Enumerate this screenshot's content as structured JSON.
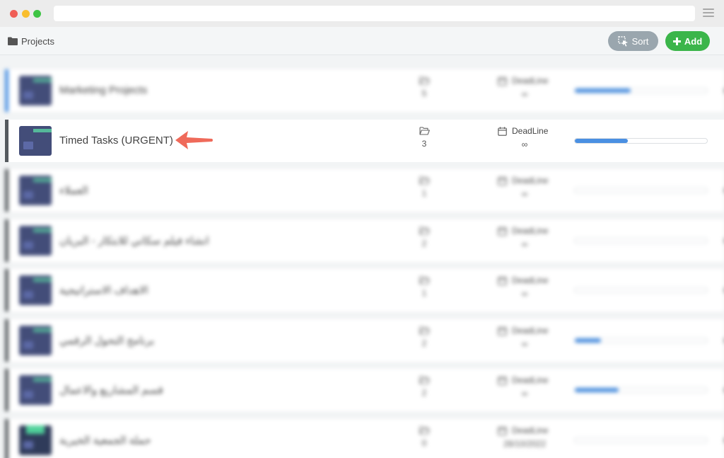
{
  "window": {},
  "breadcrumb": {
    "label": "Projects",
    "icon": "folder-icon"
  },
  "toolbar": {
    "sort_label": "Sort",
    "add_label": "Add",
    "sort_color": "#9aa6ae",
    "add_color": "#3bb54a"
  },
  "projects": [
    {
      "name": "Marketing Projects",
      "count": "5",
      "deadline_label": "DeadLine",
      "deadline": "∞",
      "progress": 0.42,
      "blurred": true
    },
    {
      "name": "Timed Tasks (URGENT)",
      "count": "3",
      "deadline_label": "DeadLine",
      "deadline": "∞",
      "progress": 0.4,
      "blurred": false,
      "highlighted": true
    },
    {
      "name": "العملاء",
      "count": "1",
      "deadline_label": "DeadLine",
      "deadline": "∞",
      "progress": 0,
      "blurred": true
    },
    {
      "name": "انشاء فيلم سكاني للابتكار - البريان",
      "count": "2",
      "deadline_label": "DeadLine",
      "deadline": "∞",
      "progress": 0,
      "blurred": true
    },
    {
      "name": "الاهداف الاستراتيجية",
      "count": "1",
      "deadline_label": "DeadLine",
      "deadline": "∞",
      "progress": 0,
      "blurred": true
    },
    {
      "name": "برنامج التحول الرقمي",
      "count": "2",
      "deadline_label": "DeadLine",
      "deadline": "∞",
      "progress": 0.2,
      "blurred": true
    },
    {
      "name": "قسم المشاريع والاعمال",
      "count": "2",
      "deadline_label": "DeadLine",
      "deadline": "∞",
      "progress": 0.33,
      "blurred": true
    },
    {
      "name": "حملة الجمعية الخيرية",
      "count": "0",
      "deadline_label": "DeadLine",
      "deadline": "28/10/2022",
      "progress": 0,
      "blurred": true
    }
  ],
  "annotation": {
    "arrow_color": "#ef6a5a"
  }
}
